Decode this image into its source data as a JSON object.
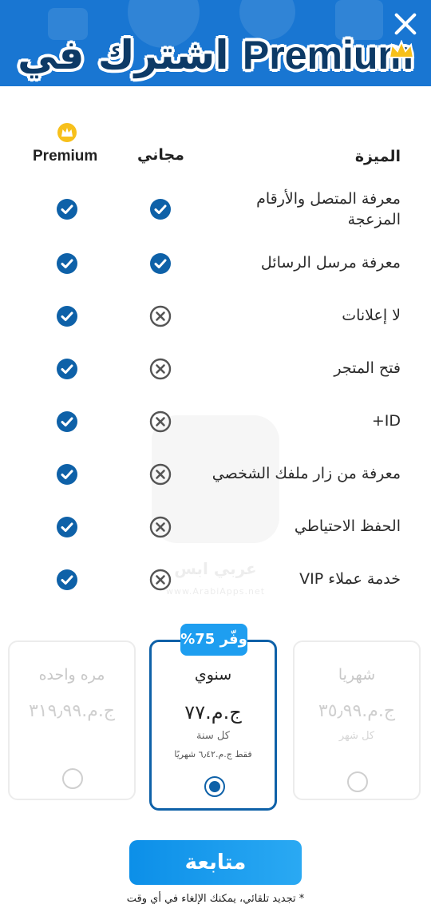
{
  "header": {
    "title_ar": "اشترك في",
    "title_en": "Premium",
    "close_icon": "close-icon",
    "brand_color": "#1976d2"
  },
  "table": {
    "col_feature": "الميزة",
    "col_free": "مجاني",
    "col_premium": "Premium",
    "rows": [
      {
        "label": "معرفة المتصل والأرقام المزعجة",
        "free": true,
        "premium": true
      },
      {
        "label": "معرفة مرسل الرسائل",
        "free": true,
        "premium": true
      },
      {
        "label": "لا إعلانات",
        "free": false,
        "premium": true
      },
      {
        "label": "فتح المتجر",
        "free": false,
        "premium": true
      },
      {
        "label": "ID+",
        "free": false,
        "premium": true
      },
      {
        "label": "معرفة من زار ملفك الشخصي",
        "free": false,
        "premium": true
      },
      {
        "label": "الحفظ الاحتياطي",
        "free": false,
        "premium": true
      },
      {
        "label": "خدمة عملاء VIP",
        "free": false,
        "premium": true
      }
    ]
  },
  "watermark": {
    "text": "عربي ابس",
    "url": "www.ArabiApps.net"
  },
  "plans": {
    "badge": "وفّر 75%",
    "once": {
      "name": "مره واحده",
      "price": "ج.م.٣١٩٫٩٩",
      "selected": false
    },
    "yearly": {
      "name": "سنوي",
      "price": "ج.م.٧٧",
      "per": "كل سنة",
      "note": "فقط ج.م.٦٫٤٢ شهريًا",
      "selected": true
    },
    "monthly": {
      "name": "شهريا",
      "price": "ج.م.٣٥٫٩٩",
      "per": "كل شهر",
      "selected": false
    }
  },
  "cta": {
    "continue_label": "متابعة",
    "renew_note": "* تجديد تلقائي، يمكنك الإلغاء في أي وقت"
  },
  "colors": {
    "check": "#0e61a8",
    "cross": "#555555",
    "accent": "#1e9ef0"
  }
}
